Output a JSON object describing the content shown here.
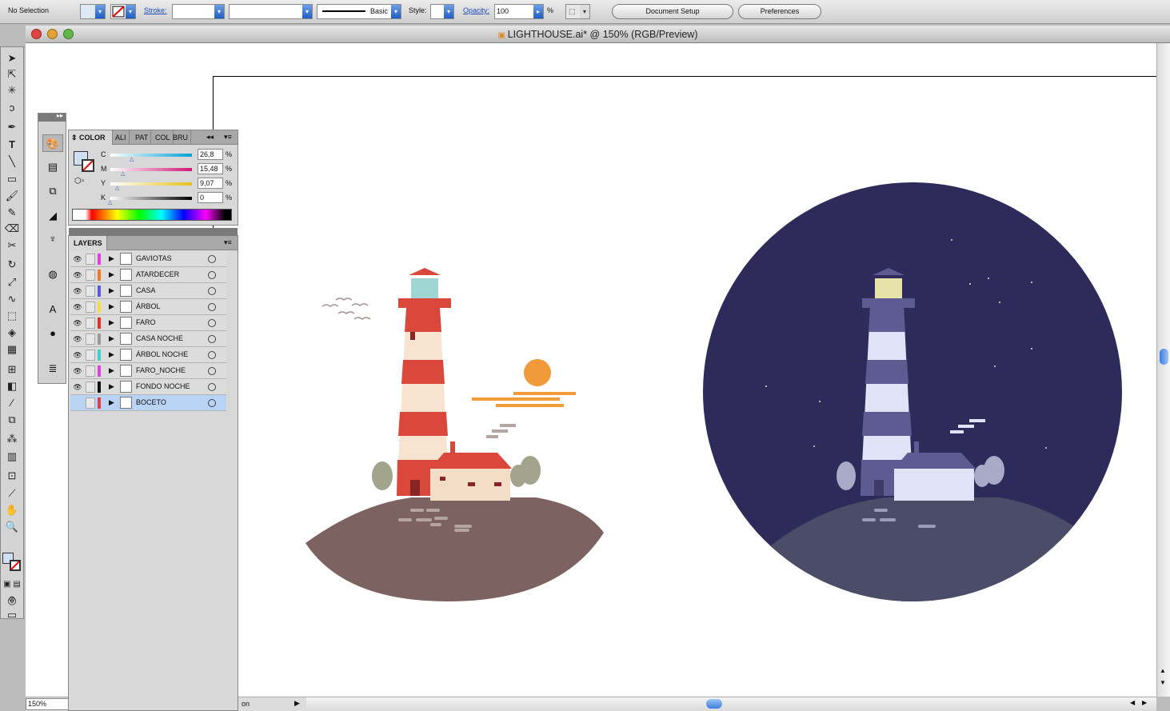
{
  "control_bar": {
    "selection": "No Selection",
    "stroke_label": "Stroke:",
    "stroke_profile": "Basic",
    "style_label": "Style:",
    "opacity_label": "Opacity:",
    "opacity_value": "100",
    "opacity_unit": "%",
    "document_setup": "Document Setup",
    "preferences": "Preferences"
  },
  "window": {
    "title": "LIGHTHOUSE.ai* @ 150% (RGB/Preview)"
  },
  "color_panel": {
    "tabs": [
      "COLOR",
      "ALI",
      "PAT",
      "COL",
      "BRU"
    ],
    "sliders": [
      {
        "letter": "C",
        "value": "26,8",
        "unit": "%"
      },
      {
        "letter": "M",
        "value": "15,48",
        "unit": "%"
      },
      {
        "letter": "Y",
        "value": "9,07",
        "unit": "%"
      },
      {
        "letter": "K",
        "value": "0",
        "unit": "%"
      }
    ]
  },
  "layers_panel": {
    "tab": "LAYERS",
    "layers": [
      {
        "name": "GAVIOTAS",
        "color": "#e040e0"
      },
      {
        "name": "ATARDECER",
        "color": "#f07820"
      },
      {
        "name": "CASA",
        "color": "#5a5ad8"
      },
      {
        "name": "ÁRBOL",
        "color": "#f0e040"
      },
      {
        "name": "FARO",
        "color": "#e03030"
      },
      {
        "name": "CASA NOCHE",
        "color": "#9a9a9a"
      },
      {
        "name": "ÁRBOL NOCHE",
        "color": "#40d0d0"
      },
      {
        "name": "FARO_NOCHE",
        "color": "#e040e0"
      },
      {
        "name": "FONDO NOCHE",
        "color": "#111111"
      },
      {
        "name": "BOCETO",
        "color": "#e04040"
      }
    ]
  },
  "status_bar": {
    "zoom": "150%",
    "status_text": "on"
  },
  "colors": {
    "night_sky": "#2e2b5b",
    "ground_day": "#7c6260",
    "ground_night": "#4a4c68",
    "sun": "#f09a3a",
    "lighthouse_red": "#d9483b"
  }
}
